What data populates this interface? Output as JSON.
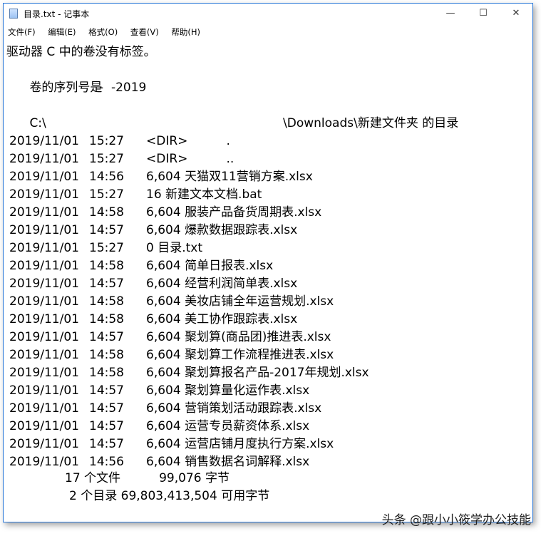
{
  "window": {
    "title": "目录.txt - 记事本",
    "controls": {
      "minimize": "—",
      "maximize": "☐",
      "close": "✕"
    }
  },
  "menu": [
    "文件(F)",
    "编辑(E)",
    "格式(O)",
    "查看(V)",
    "帮助(H)"
  ],
  "header": {
    "volume_label": "驱动器 C 中的卷没有标签。",
    "serial_prefix": "卷的序列号是",
    "serial_partial": "-  -2019",
    "dir_prefix": "C:\\",
    "dir_suffix": "\\Downloads\\新建文件夹 的目录"
  },
  "entries": [
    {
      "date": "2019/11/01",
      "time": "15:27",
      "info": "<DIR>          ."
    },
    {
      "date": "2019/11/01",
      "time": "15:27",
      "info": "<DIR>          .."
    },
    {
      "date": "2019/11/01",
      "time": "14:56",
      "info": "6,604 天猫双11营销方案.xlsx"
    },
    {
      "date": "2019/11/01",
      "time": "15:27",
      "info": "16 新建文本文档.bat"
    },
    {
      "date": "2019/11/01",
      "time": "14:58",
      "info": "6,604 服装产品备货周期表.xlsx"
    },
    {
      "date": "2019/11/01",
      "time": "14:57",
      "info": "6,604 爆款数据跟踪表.xlsx"
    },
    {
      "date": "2019/11/01",
      "time": "15:27",
      "info": "0 目录.txt"
    },
    {
      "date": "2019/11/01",
      "time": "14:58",
      "info": "6,604 简单日报表.xlsx"
    },
    {
      "date": "2019/11/01",
      "time": "14:57",
      "info": "6,604 经营利润简单表.xlsx"
    },
    {
      "date": "2019/11/01",
      "time": "14:58",
      "info": "6,604 美妆店铺全年运营规划.xlsx"
    },
    {
      "date": "2019/11/01",
      "time": "14:58",
      "info": "6,604 美工协作跟踪表.xlsx"
    },
    {
      "date": "2019/11/01",
      "time": "14:57",
      "info": "6,604 聚划算(商品团)推进表.xlsx"
    },
    {
      "date": "2019/11/01",
      "time": "14:58",
      "info": "6,604 聚划算工作流程推进表.xlsx"
    },
    {
      "date": "2019/11/01",
      "time": "14:58",
      "info": "6,604 聚划算报名产品-2017年规划.xlsx"
    },
    {
      "date": "2019/11/01",
      "time": "14:57",
      "info": "6,604 聚划算量化运作表.xlsx"
    },
    {
      "date": "2019/11/01",
      "time": "14:57",
      "info": "6,604 营销策划活动跟踪表.xlsx"
    },
    {
      "date": "2019/11/01",
      "time": "14:57",
      "info": "6,604 运营专员薪资体系.xlsx"
    },
    {
      "date": "2019/11/01",
      "time": "14:57",
      "info": "6,604 运营店铺月度执行方案.xlsx"
    },
    {
      "date": "2019/11/01",
      "time": "14:56",
      "info": "6,604 销售数据名词解释.xlsx"
    }
  ],
  "summary": {
    "files": "17 个文件          99,076 字节",
    "dirs": "2 个目录 69,803,413,504 可用字节"
  },
  "watermark": "头条 @跟小小筱学办公技能"
}
